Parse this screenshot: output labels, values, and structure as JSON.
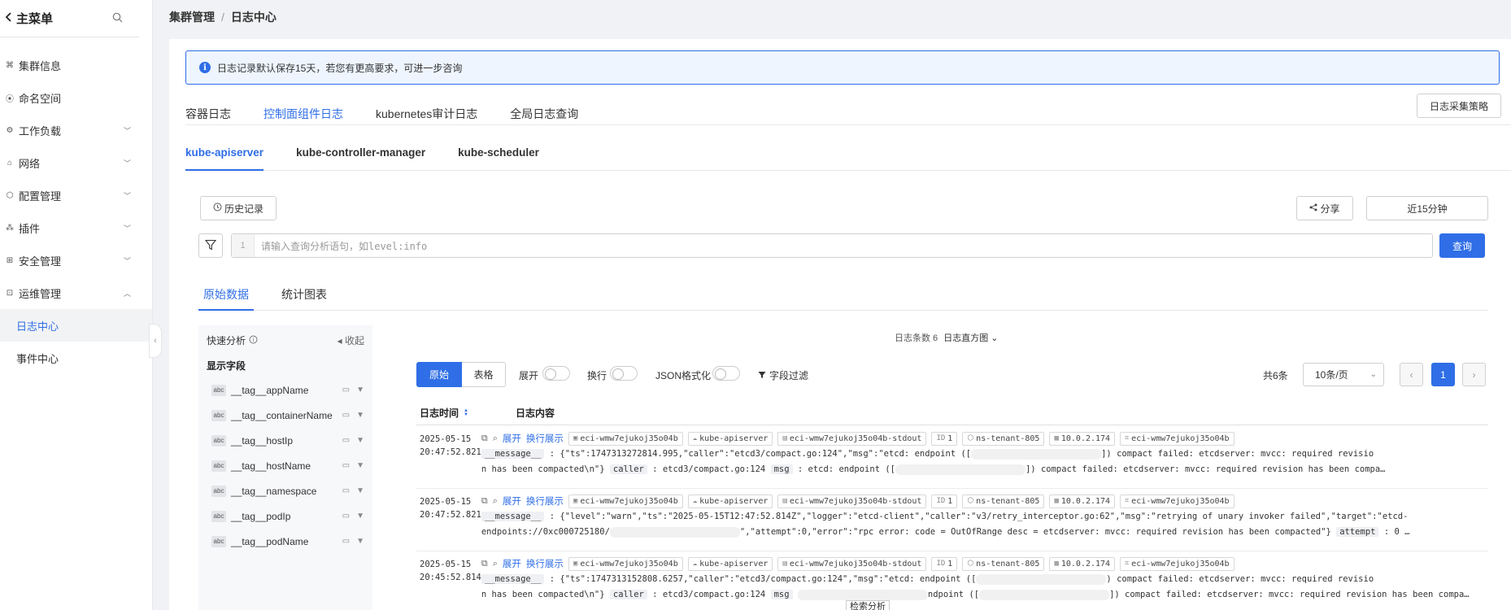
{
  "sidebar": {
    "title": "主菜单",
    "items": [
      {
        "label": "集群信息",
        "icon": "cluster-icon",
        "expandable": false
      },
      {
        "label": "命名空间",
        "icon": "namespace-icon",
        "expandable": false
      },
      {
        "label": "工作负载",
        "icon": "workload-icon",
        "expandable": true
      },
      {
        "label": "网络",
        "icon": "network-icon",
        "expandable": true
      },
      {
        "label": "配置管理",
        "icon": "config-icon",
        "expandable": true
      },
      {
        "label": "插件",
        "icon": "plugin-icon",
        "expandable": true
      },
      {
        "label": "安全管理",
        "icon": "security-icon",
        "expandable": true
      },
      {
        "label": "运维管理",
        "icon": "ops-icon",
        "expandable": true,
        "expanded": true
      }
    ],
    "sub_items": [
      {
        "label": "日志中心",
        "active": true
      },
      {
        "label": "事件中心",
        "active": false
      }
    ]
  },
  "breadcrumb": {
    "parent": "集群管理",
    "current": "日志中心"
  },
  "notice": {
    "text": "日志记录默认保存15天，若您有更高要求，可进一步咨询"
  },
  "main_tabs": [
    "容器日志",
    "控制面组件日志",
    "kubernetes审计日志",
    "全局日志查询"
  ],
  "main_tab_active": 1,
  "policy_button": "日志采集策略",
  "component_tabs": [
    "kube-apiserver",
    "kube-controller-manager",
    "kube-scheduler"
  ],
  "history_button": "历史记录",
  "share_button": "分享",
  "time_range": "近15分钟",
  "query": {
    "line_no": "1",
    "placeholder": "请输入查询分析语句，如level:info",
    "button": "查询"
  },
  "view_tabs": [
    "原始数据",
    "统计图表"
  ],
  "quick_analysis": {
    "title": "快速分析",
    "collapse": "收起",
    "section": "显示字段",
    "fields": [
      "__tag__appName",
      "__tag__containerName",
      "__tag__hostIp",
      "__tag__hostName",
      "__tag__namespace",
      "__tag__podIp",
      "__tag__podName"
    ]
  },
  "log_summary": {
    "count_label": "日志条数 6",
    "histogram": "日志直方图"
  },
  "toolbar": {
    "raw": "原始",
    "table": "表格",
    "expand": "展开",
    "wrap": "换行",
    "json": "JSON格式化",
    "field_filter": "字段过滤",
    "total": "共6条",
    "page_size": "10条/页",
    "page": "1"
  },
  "table_header": {
    "time": "日志时间",
    "content": "日志内容"
  },
  "row_actions": {
    "expand": "展开",
    "wrap_show": "换行展示"
  },
  "rows": [
    {
      "date": "2025-05-15",
      "time": "20:47:52.821",
      "tags": [
        "eci-wmw7ejukoj35o04b",
        "kube-apiserver",
        "eci-wmw7ejukoj35o04b-stdout",
        "1",
        "ns-tenant-805",
        "10.0.2.174",
        "eci-wmw7ejukoj35o04b"
      ],
      "line1_key": "__message__",
      "line1_a": ": {\"ts\":1747313272814.995,\"caller\":\"etcd3/compact.go:124\",\"msg\":\"etcd: endpoint ([",
      "line1_b": "]) compact failed: etcdserver: mvcc: required revisio",
      "line2_a": "n has been compacted\\n\"}",
      "line2_k1": "caller",
      "line2_v1": ": etcd3/compact.go:124",
      "line2_k2": "msg",
      "line2_v2": ": etcd: endpoint ([",
      "line2_b": "]) compact failed: etcdserver: mvcc: required revision has been compa…"
    },
    {
      "date": "2025-05-15",
      "time": "20:47:52.821",
      "tags": [
        "eci-wmw7ejukoj35o04b",
        "kube-apiserver",
        "eci-wmw7ejukoj35o04b-stdout",
        "1",
        "ns-tenant-805",
        "10.0.2.174",
        "eci-wmw7ejukoj35o04b"
      ],
      "line1_key": "__message__",
      "line1_a": ": {\"level\":\"warn\",\"ts\":\"2025-05-15T12:47:52.814Z\",\"logger\":\"etcd-client\",\"caller\":\"v3/retry_interceptor.go:62\",\"msg\":\"retrying of unary invoker failed\",\"target\":\"etcd-",
      "line1_b": "",
      "line2_a": "endpoints://0xc000725180/",
      "line2_k1": "",
      "line2_v1": "\",\"attempt\":0,\"error\":\"rpc error: code = OutOfRange desc = etcdserver: mvcc: required revision has been compacted\"}",
      "line2_k2": "attempt",
      "line2_v2": ": 0 …",
      "line2_b": ""
    },
    {
      "date": "2025-05-15",
      "time": "20:45:52.814",
      "tags": [
        "eci-wmw7ejukoj35o04b",
        "kube-apiserver",
        "eci-wmw7ejukoj35o04b-stdout",
        "1",
        "ns-tenant-805",
        "10.0.2.174",
        "eci-wmw7ejukoj35o04b"
      ],
      "line1_key": "__message__",
      "line1_a": ": {\"ts\":1747313152808.6257,\"caller\":\"etcd3/compact.go:124\",\"msg\":\"etcd: endpoint ([",
      "line1_b": ") compact failed: etcdserver: mvcc: required revisio",
      "line2_a": "n has been compacted\\n\"}",
      "line2_k1": "caller",
      "line2_v1": ": etcd3/compact.go:124",
      "line2_k2": "msg",
      "line2_v2": "",
      "line2_b": "ndpoint ([",
      "line2_c": "]) compact failed: etcdserver: mvcc: required revision has been compa…"
    }
  ],
  "tooltip": "检索分析"
}
